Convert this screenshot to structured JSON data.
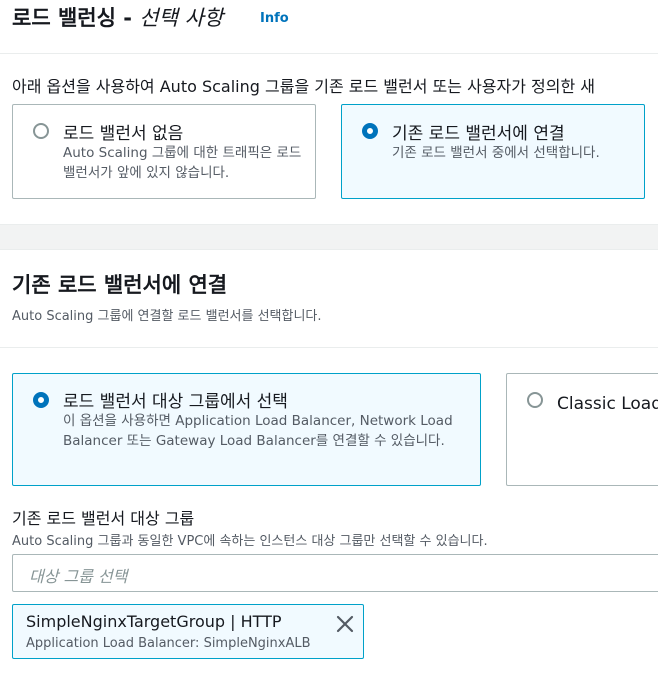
{
  "section1": {
    "title": "로드 밸런싱 - ",
    "title_optional": "선택 사항",
    "info_link": "Info",
    "description": "아래 옵션을 사용하여 Auto Scaling 그룹을 기존 로드 밸런서 또는 사용자가 정의한 새"
  },
  "lb_options": [
    {
      "title": "로드 밸런서 없음",
      "desc": "Auto Scaling 그룹에 대한 트래픽은 로드 밸런서가 앞에 있지 않습니다."
    },
    {
      "title": "기존 로드 밸런서에 연결",
      "desc": "기존 로드 밸런서 중에서 선택합니다."
    }
  ],
  "section2": {
    "title": "기존 로드 밸런서에 연결",
    "description": "Auto Scaling 그룹에 연결할 로드 밸런서를 선택합니다."
  },
  "attach_options": [
    {
      "title": "로드 밸런서 대상 그룹에서 선택",
      "desc": "이 옵션을 사용하면 Application Load Balancer, Network Load Balancer 또는 Gateway Load Balancer를 연결할 수 있습니다."
    },
    {
      "title": "Classic Load Balancers에서 선택"
    }
  ],
  "target_group": {
    "label": "기존 로드 밸런서 대상 그룹",
    "description": "Auto Scaling 그룹과 동일한 VPC에 속하는 인스턴스 대상 그룹만 선택할 수 있습니다.",
    "placeholder": "대상 그룹 선택",
    "selected": {
      "title": "SimpleNginxTargetGroup | HTTP",
      "subtitle": "Application Load Balancer: SimpleNginxALB"
    }
  },
  "colors": {
    "accent": "#0073bb",
    "selected_border": "#00a1c9",
    "selected_bg": "#f1faff"
  }
}
